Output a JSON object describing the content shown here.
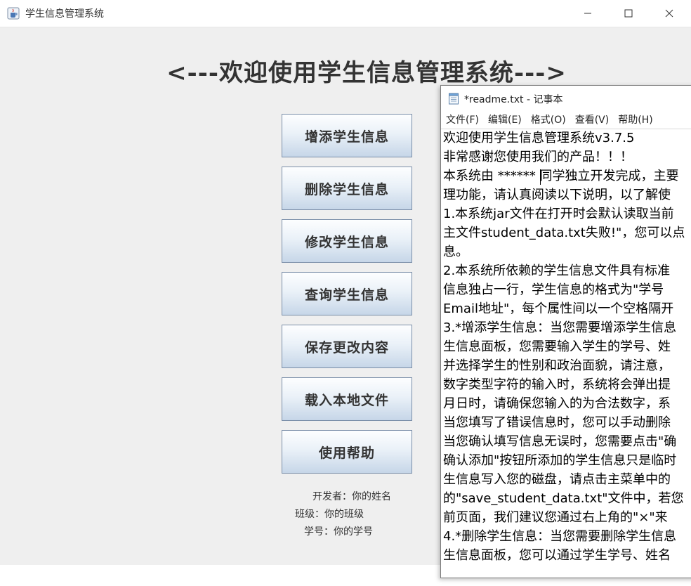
{
  "main_window": {
    "title": "学生信息管理系统",
    "heading": "<---欢迎使用学生信息管理系统--->",
    "controls": {
      "minimize": "—",
      "maximize": "☐",
      "close": "✕"
    },
    "buttons": [
      "增添学生信息",
      "删除学生信息",
      "修改学生信息",
      "查询学生信息",
      "保存更改内容",
      "载入本地文件",
      "使用帮助"
    ],
    "info": {
      "developer": "开发者：你的姓名",
      "class": "班级：你的班级",
      "student_id": "学号：你的学号"
    }
  },
  "notepad": {
    "title": "*readme.txt - 记事本",
    "menus": [
      "文件(F)",
      "编辑(E)",
      "格式(O)",
      "查看(V)",
      "帮助(H)"
    ],
    "lines": [
      "欢迎使用学生信息管理系统v3.7.5",
      "非常感谢您使用我们的产品！！！",
      "本系统由 ****** 同学独立开发完成，主要",
      "理功能，请认真阅读以下说明，以了解使",
      "1.本系统jar文件在打开时会默认读取当前",
      "主文件student_data.txt失败!\"，您可以点",
      "息。",
      "2.本系统所依赖的学生信息文件具有标准",
      "信息独占一行，学生信息的格式为\"学号",
      "Email地址\"，每个属性间以一个空格隔开",
      "3.*增添学生信息：当您需要增添学生信息",
      "生信息面板，您需要输入学生的学号、姓",
      "并选择学生的性别和政治面貌，请注意，",
      "数字类型字符的输入时，系统将会弹出提",
      "月日时，请确保您输入的为合法数字，系",
      "当您填写了错误信息时，您可以手动删除",
      "当您确认填写信息无误时，您需要点击\"确",
      "确认添加\"按钮所添加的学生信息只是临时",
      "生信息写入您的磁盘，请点击主菜单中的",
      "的\"save_student_data.txt\"文件中，若您",
      "前页面，我们建议您通过右上角的\"×\"来",
      "4.*删除学生信息：当您需要删除学生信息",
      "生信息面板，您可以通过学生学号、姓名"
    ]
  },
  "colors": {
    "button_border": "#7a8ea8",
    "button_gradient_bottom": "#c6d6e8",
    "window_bg": "#efefef"
  },
  "icons": {
    "app": "java-cup-icon",
    "notepad": "notepad-icon"
  }
}
